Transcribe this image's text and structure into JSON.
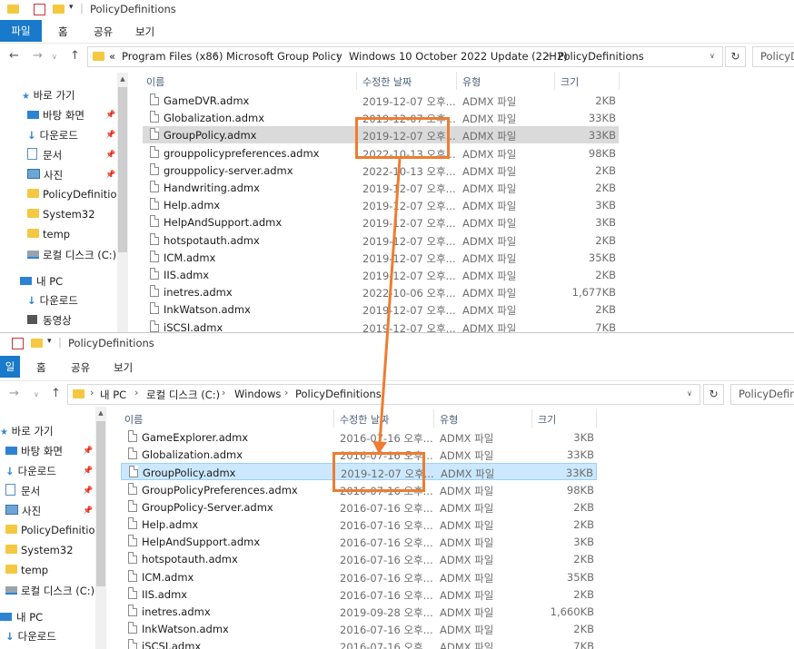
{
  "top": {
    "title": "PolicyDefinitions",
    "ribbon": [
      "파일",
      "홈",
      "공유",
      "보기"
    ],
    "address": [
      "«",
      "Program Files (x86)",
      "Microsoft Group Policy",
      "Windows 10 October 2022 Update (22H2)",
      "PolicyDefinitions"
    ],
    "search": "PolicyD",
    "nav": {
      "quick_access": "바로 가기",
      "items": [
        {
          "label": "바탕 화면",
          "icon": "desktop-icon",
          "pinned": true
        },
        {
          "label": "다운로드",
          "icon": "download-icon",
          "pinned": true
        },
        {
          "label": "문서",
          "icon": "document-icon",
          "pinned": true
        },
        {
          "label": "사진",
          "icon": "picture-icon",
          "pinned": true
        },
        {
          "label": "PolicyDefinition",
          "icon": "folder-icon",
          "pinned": false
        },
        {
          "label": "System32",
          "icon": "folder-icon",
          "pinned": false
        },
        {
          "label": "temp",
          "icon": "folder-icon",
          "pinned": false
        },
        {
          "label": "로컬 디스크 (C:)",
          "icon": "drive-icon",
          "pinned": false
        }
      ],
      "this_pc": "내 PC",
      "pc_items": [
        {
          "label": "다운로드",
          "icon": "download-icon"
        },
        {
          "label": "동영상",
          "icon": "video-icon"
        }
      ]
    },
    "columns": [
      "이름",
      "수정한 날짜",
      "유형",
      "크기"
    ],
    "rows": [
      {
        "name": "GameDVR.admx",
        "date": "2019-12-07 오후...",
        "type": "ADMX 파일",
        "size": "2KB"
      },
      {
        "name": "Globalization.admx",
        "date": "2019-12-07 오후...",
        "type": "ADMX 파일",
        "size": "33KB"
      },
      {
        "name": "GroupPolicy.admx",
        "date": "2019-12-07 오후...",
        "type": "ADMX 파일",
        "size": "33KB",
        "selected": true
      },
      {
        "name": "grouppolicypreferences.admx",
        "date": "2022-10-13 오후...",
        "type": "ADMX 파일",
        "size": "98KB"
      },
      {
        "name": "grouppolicy-server.admx",
        "date": "2022-10-13 오후...",
        "type": "ADMX 파일",
        "size": "2KB"
      },
      {
        "name": "Handwriting.admx",
        "date": "2019-12-07 오후...",
        "type": "ADMX 파일",
        "size": "2KB"
      },
      {
        "name": "Help.admx",
        "date": "2019-12-07 오후...",
        "type": "ADMX 파일",
        "size": "3KB"
      },
      {
        "name": "HelpAndSupport.admx",
        "date": "2019-12-07 오후...",
        "type": "ADMX 파일",
        "size": "3KB"
      },
      {
        "name": "hotspotauth.admx",
        "date": "2019-12-07 오후...",
        "type": "ADMX 파일",
        "size": "2KB"
      },
      {
        "name": "ICM.admx",
        "date": "2019-12-07 오후...",
        "type": "ADMX 파일",
        "size": "35KB"
      },
      {
        "name": "IIS.admx",
        "date": "2019-12-07 오후...",
        "type": "ADMX 파일",
        "size": "2KB"
      },
      {
        "name": "inetres.admx",
        "date": "2022-10-06 오후...",
        "type": "ADMX 파일",
        "size": "1,677KB"
      },
      {
        "name": "InkWatson.admx",
        "date": "2019-12-07 오후...",
        "type": "ADMX 파일",
        "size": "2KB"
      },
      {
        "name": "iSCSI.admx",
        "date": "2019-12-07 오후...",
        "type": "ADMX 파일",
        "size": "7KB"
      }
    ]
  },
  "bottom": {
    "title": "PolicyDefinitions",
    "ribbon": [
      "일",
      "홈",
      "공유",
      "보기"
    ],
    "address": [
      "내 PC",
      "로컬 디스크 (C:)",
      "Windows",
      "PolicyDefinitions"
    ],
    "search": "PolicyDefinit",
    "nav": {
      "quick_access": "바로 가기",
      "items": [
        {
          "label": "바탕 화면",
          "icon": "desktop-icon",
          "pinned": true
        },
        {
          "label": "다운로드",
          "icon": "download-icon",
          "pinned": true
        },
        {
          "label": "문서",
          "icon": "document-icon",
          "pinned": true
        },
        {
          "label": "사진",
          "icon": "picture-icon",
          "pinned": true
        },
        {
          "label": "PolicyDefinition",
          "icon": "folder-icon",
          "pinned": false
        },
        {
          "label": "System32",
          "icon": "folder-icon",
          "pinned": false
        },
        {
          "label": "temp",
          "icon": "folder-icon",
          "pinned": false
        },
        {
          "label": "로컬 디스크 (C:)",
          "icon": "drive-icon",
          "pinned": false
        }
      ],
      "this_pc": "내 PC",
      "pc_items": [
        {
          "label": "다운로드",
          "icon": "download-icon"
        }
      ]
    },
    "columns": [
      "이름",
      "수정한 날짜",
      "유형",
      "크기"
    ],
    "rows": [
      {
        "name": "GameExplorer.admx",
        "date": "2016-07-16 오후...",
        "type": "ADMX 파일",
        "size": "3KB"
      },
      {
        "name": "Globalization.admx",
        "date": "2016-07-16 오후...",
        "type": "ADMX 파일",
        "size": "33KB"
      },
      {
        "name": "GroupPolicy.admx",
        "date": "2019-12-07 오후...",
        "type": "ADMX 파일",
        "size": "33KB",
        "selected": true
      },
      {
        "name": "GroupPolicyPreferences.admx",
        "date": "2016-07-16 오후...",
        "type": "ADMX 파일",
        "size": "98KB"
      },
      {
        "name": "GroupPolicy-Server.admx",
        "date": "2016-07-16 오후...",
        "type": "ADMX 파일",
        "size": "2KB"
      },
      {
        "name": "Help.admx",
        "date": "2016-07-16 오후...",
        "type": "ADMX 파일",
        "size": "2KB"
      },
      {
        "name": "HelpAndSupport.admx",
        "date": "2016-07-16 오후...",
        "type": "ADMX 파일",
        "size": "3KB"
      },
      {
        "name": "hotspotauth.admx",
        "date": "2016-07-16 오후...",
        "type": "ADMX 파일",
        "size": "2KB"
      },
      {
        "name": "ICM.admx",
        "date": "2016-07-16 오후...",
        "type": "ADMX 파일",
        "size": "35KB"
      },
      {
        "name": "IIS.admx",
        "date": "2016-07-16 오후...",
        "type": "ADMX 파일",
        "size": "2KB"
      },
      {
        "name": "inetres.admx",
        "date": "2019-09-28 오후...",
        "type": "ADMX 파일",
        "size": "1,660KB"
      },
      {
        "name": "InkWatson.admx",
        "date": "2016-07-16 오후...",
        "type": "ADMX 파일",
        "size": "2KB"
      },
      {
        "name": "iSCSI.admx",
        "date": "2016-07-16 오후...",
        "type": "ADMX 파일",
        "size": "7KB"
      }
    ]
  },
  "annotation": {
    "color": "#ed7d31"
  }
}
